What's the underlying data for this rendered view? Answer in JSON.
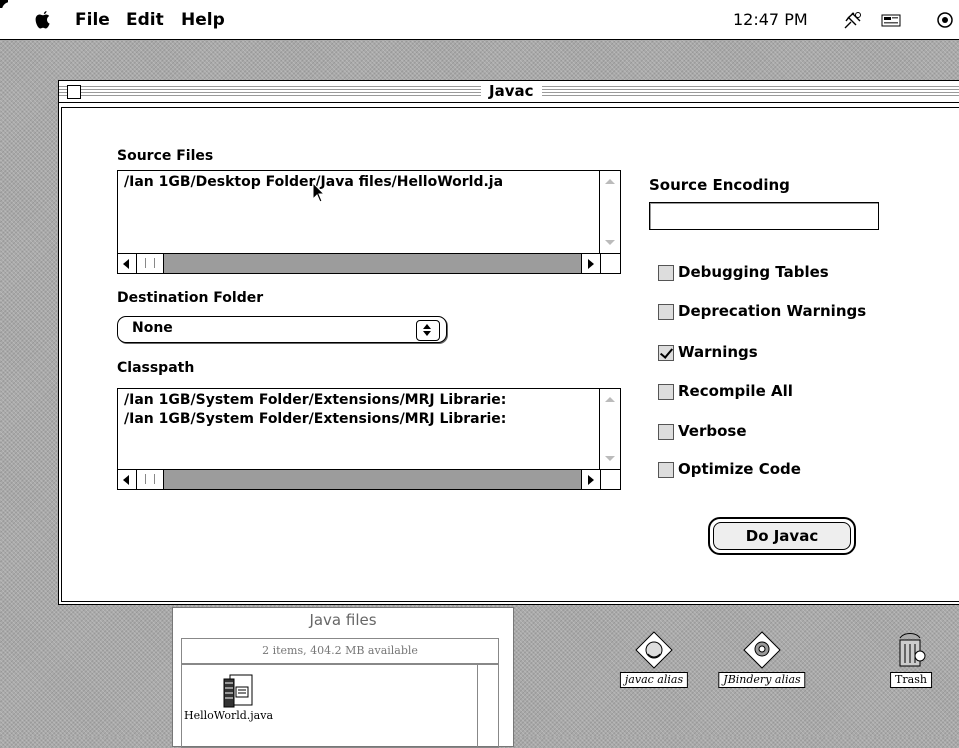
{
  "menubar": {
    "items": [
      "File",
      "Edit",
      "Help"
    ],
    "clock": "12:47 PM"
  },
  "window": {
    "title": "Javac",
    "source_files": {
      "label": "Source Files",
      "items": [
        "/Ian 1GB/Desktop Folder/Java files/HelloWorld.ja"
      ]
    },
    "destination_folder": {
      "label": "Destination Folder",
      "value": "None"
    },
    "classpath": {
      "label": "Classpath",
      "items": [
        "/Ian 1GB/System Folder/Extensions/MRJ Librarie:",
        "/Ian 1GB/System Folder/Extensions/MRJ Librarie:"
      ]
    },
    "source_encoding": {
      "label": "Source Encoding",
      "value": ""
    },
    "options": [
      {
        "label": "Debugging Tables",
        "checked": false
      },
      {
        "label": "Deprecation Warnings",
        "checked": false
      },
      {
        "label": "Warnings",
        "checked": true
      },
      {
        "label": "Recompile All",
        "checked": false
      },
      {
        "label": "Verbose",
        "checked": false
      },
      {
        "label": "Optimize Code",
        "checked": false
      }
    ],
    "do_button": "Do Javac"
  },
  "finder": {
    "title": "Java files",
    "info": "2 items, 404.2 MB available",
    "file": "HelloWorld.java"
  },
  "desktop": {
    "icons": [
      "javac alias",
      "JBindery alias",
      "Trash"
    ]
  }
}
